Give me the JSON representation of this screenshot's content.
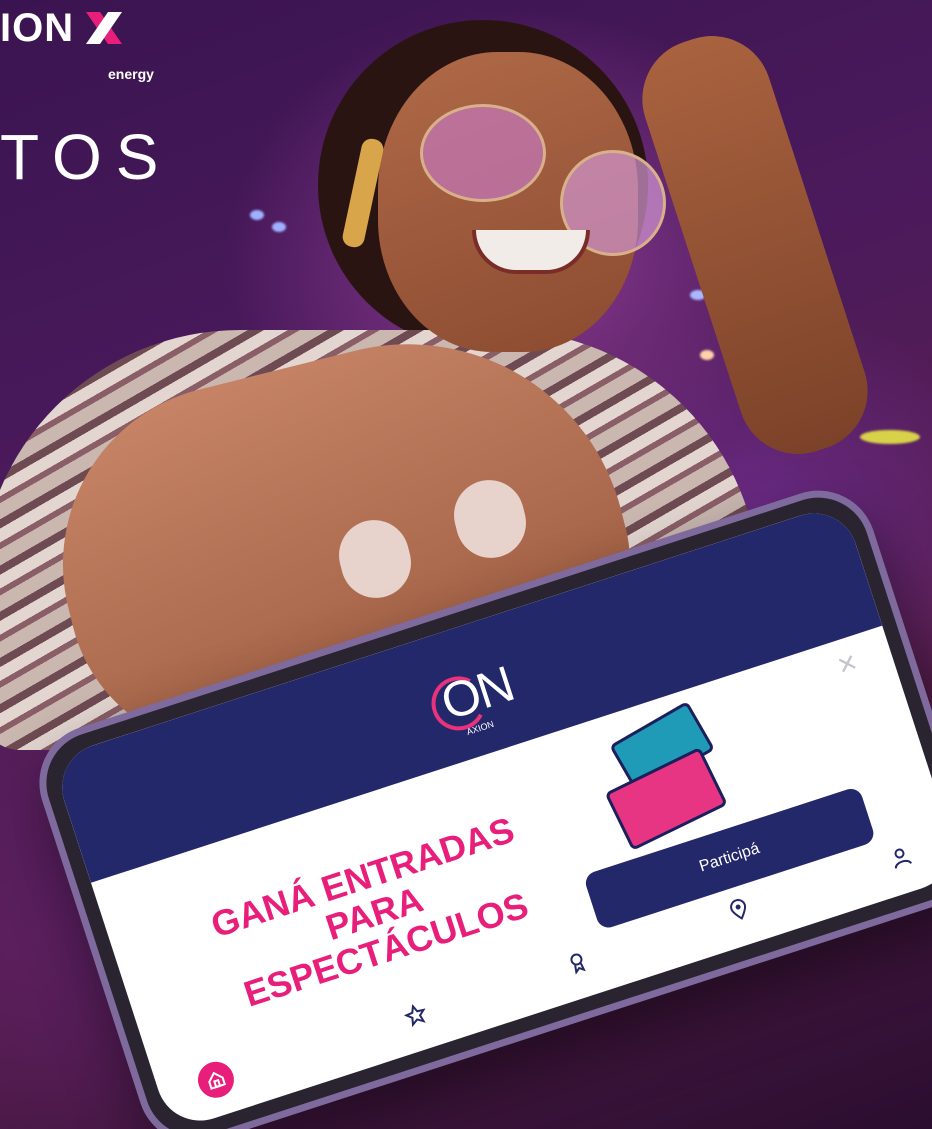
{
  "brand": {
    "name": "ION",
    "sub": "energy"
  },
  "headline_fragment": "TOS",
  "app": {
    "logo": {
      "text": "ON",
      "sub": "AXION"
    },
    "promo_title": "GANÁ ENTRADAS PARA ESPECTÁCULOS",
    "cta_label": "Participá",
    "close_glyph": "×",
    "nav": [
      {
        "name": "home",
        "icon": "home-icon"
      },
      {
        "name": "favorites",
        "icon": "star-icon"
      },
      {
        "name": "rewards",
        "icon": "award-icon"
      },
      {
        "name": "locations",
        "icon": "location-pin-icon"
      },
      {
        "name": "profile",
        "icon": "user-icon"
      }
    ]
  },
  "colors": {
    "brand_pink": "#e81f7a",
    "brand_navy": "#23286a"
  }
}
